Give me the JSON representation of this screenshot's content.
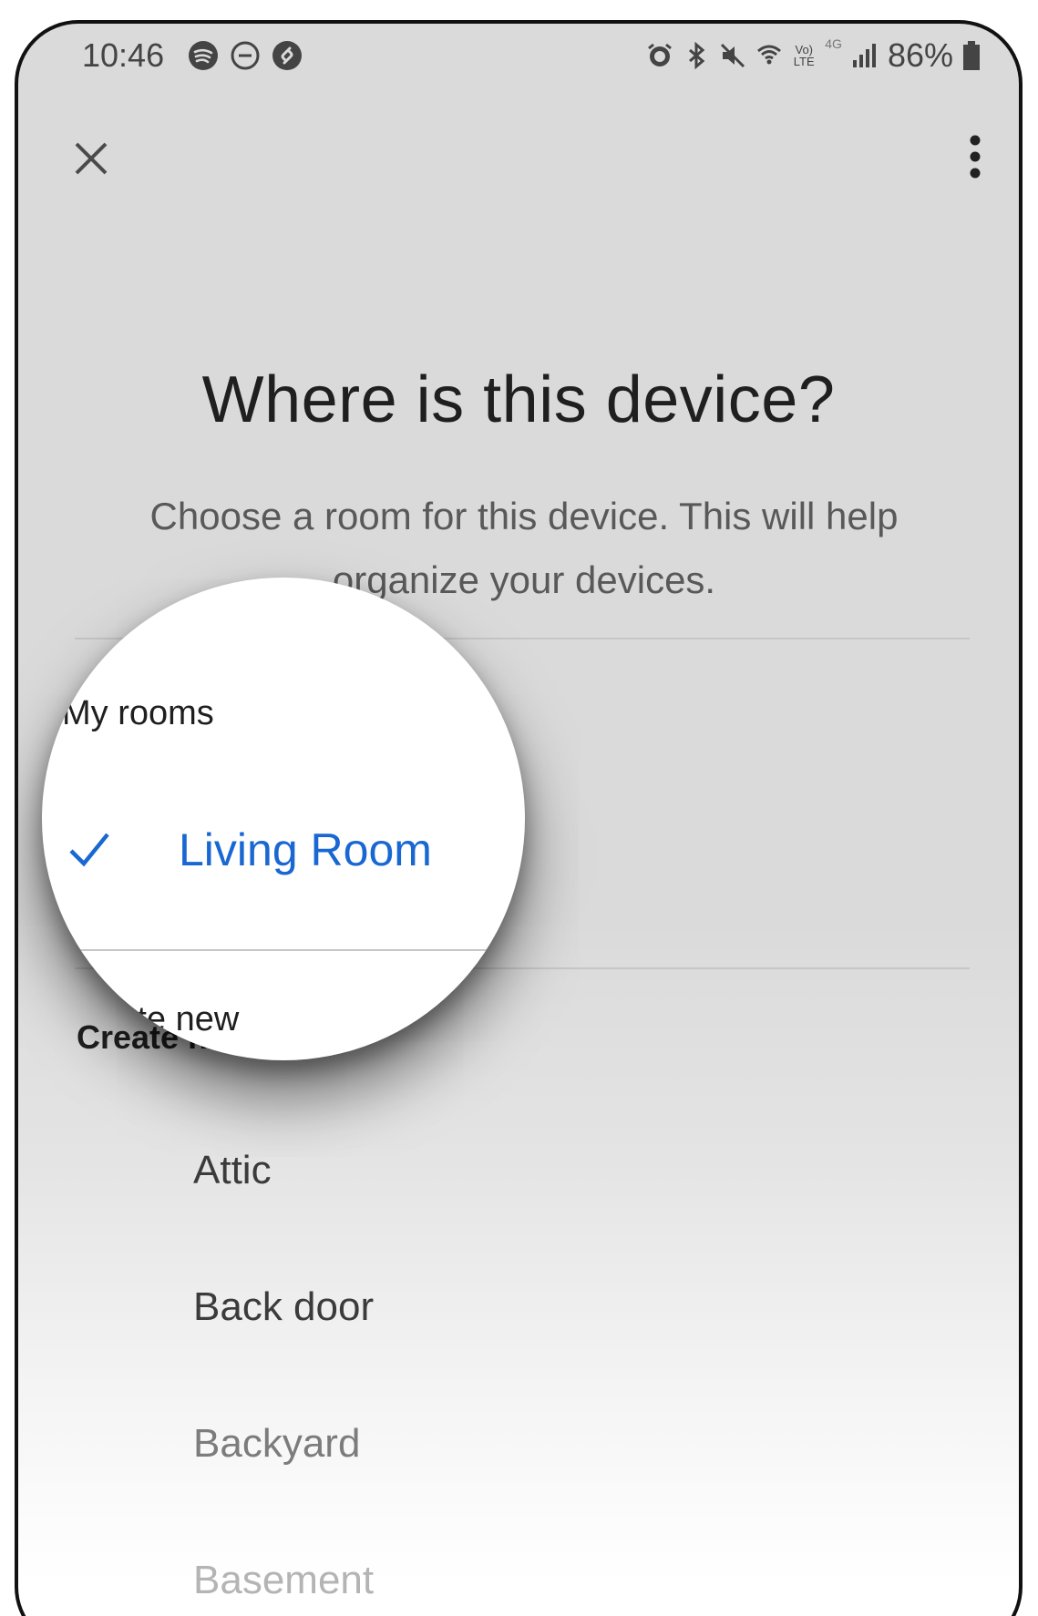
{
  "status_bar": {
    "time": "10:46",
    "battery_percent": "86%",
    "left_icons": [
      "spotify-icon",
      "dnd-icon",
      "shazam-icon"
    ],
    "right_icons": [
      "alarm-icon",
      "bluetooth-icon",
      "mute-icon",
      "wifi-icon",
      "volte-icon",
      "signal-icon",
      "battery-icon"
    ],
    "volte_label": "Vo) LTE",
    "network_label": "4G"
  },
  "toolbar": {
    "close_icon": "close-icon",
    "more_icon": "more-vert-icon"
  },
  "main": {
    "title": "Where is this device?",
    "subtitle": "Choose a room for this device. This will help organize your devices."
  },
  "my_rooms": {
    "label": "My rooms",
    "items": [
      {
        "label": "Living Room",
        "selected": true
      }
    ]
  },
  "create_new": {
    "label": "Create new",
    "items": [
      {
        "label": "Attic"
      },
      {
        "label": "Back door"
      },
      {
        "label": "Backyard"
      },
      {
        "label": "Basement"
      }
    ]
  },
  "colors": {
    "accent": "#1967d2",
    "background": "#dadada",
    "text_primary": "#1f1f1f",
    "text_secondary": "#595959"
  }
}
